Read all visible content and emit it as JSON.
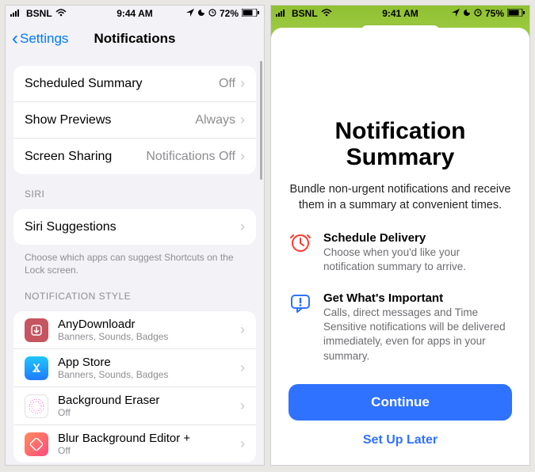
{
  "left": {
    "status": {
      "carrier": "BSNL",
      "time": "9:44 AM",
      "battery": "72%"
    },
    "nav": {
      "back": "Settings",
      "title": "Notifications"
    },
    "general": [
      {
        "label": "Scheduled Summary",
        "value": "Off"
      },
      {
        "label": "Show Previews",
        "value": "Always"
      },
      {
        "label": "Screen Sharing",
        "value": "Notifications Off"
      }
    ],
    "siri_header": "SIRI",
    "siri_row": "Siri Suggestions",
    "siri_footer": "Choose which apps can suggest Shortcuts on the Lock screen.",
    "style_header": "NOTIFICATION STYLE",
    "apps": [
      {
        "name": "AnyDownloadr",
        "sub": "Banners, Sounds, Badges",
        "color": "#c5555f"
      },
      {
        "name": "App Store",
        "sub": "Banners, Sounds, Badges",
        "color": "#1fa2ff"
      },
      {
        "name": "Background Eraser",
        "sub": "Off",
        "color": "#eeeeee"
      },
      {
        "name": "Blur Background Editor +",
        "sub": "Off",
        "color": "#ff6a4d"
      }
    ]
  },
  "right": {
    "status": {
      "carrier": "BSNL",
      "time": "9:41 AM",
      "battery": "75%"
    },
    "title": "Notification Summary",
    "lead": "Bundle non-urgent notifications and receive them in a summary at convenient times.",
    "features": [
      {
        "title": "Schedule Delivery",
        "desc": "Choose when you'd like your notification summary to arrive."
      },
      {
        "title": "Get What's Important",
        "desc": "Calls, direct messages and Time Sensitive notifications will be delivered immediately, even for apps in your summary."
      }
    ],
    "primary": "Continue",
    "secondary": "Set Up Later"
  }
}
